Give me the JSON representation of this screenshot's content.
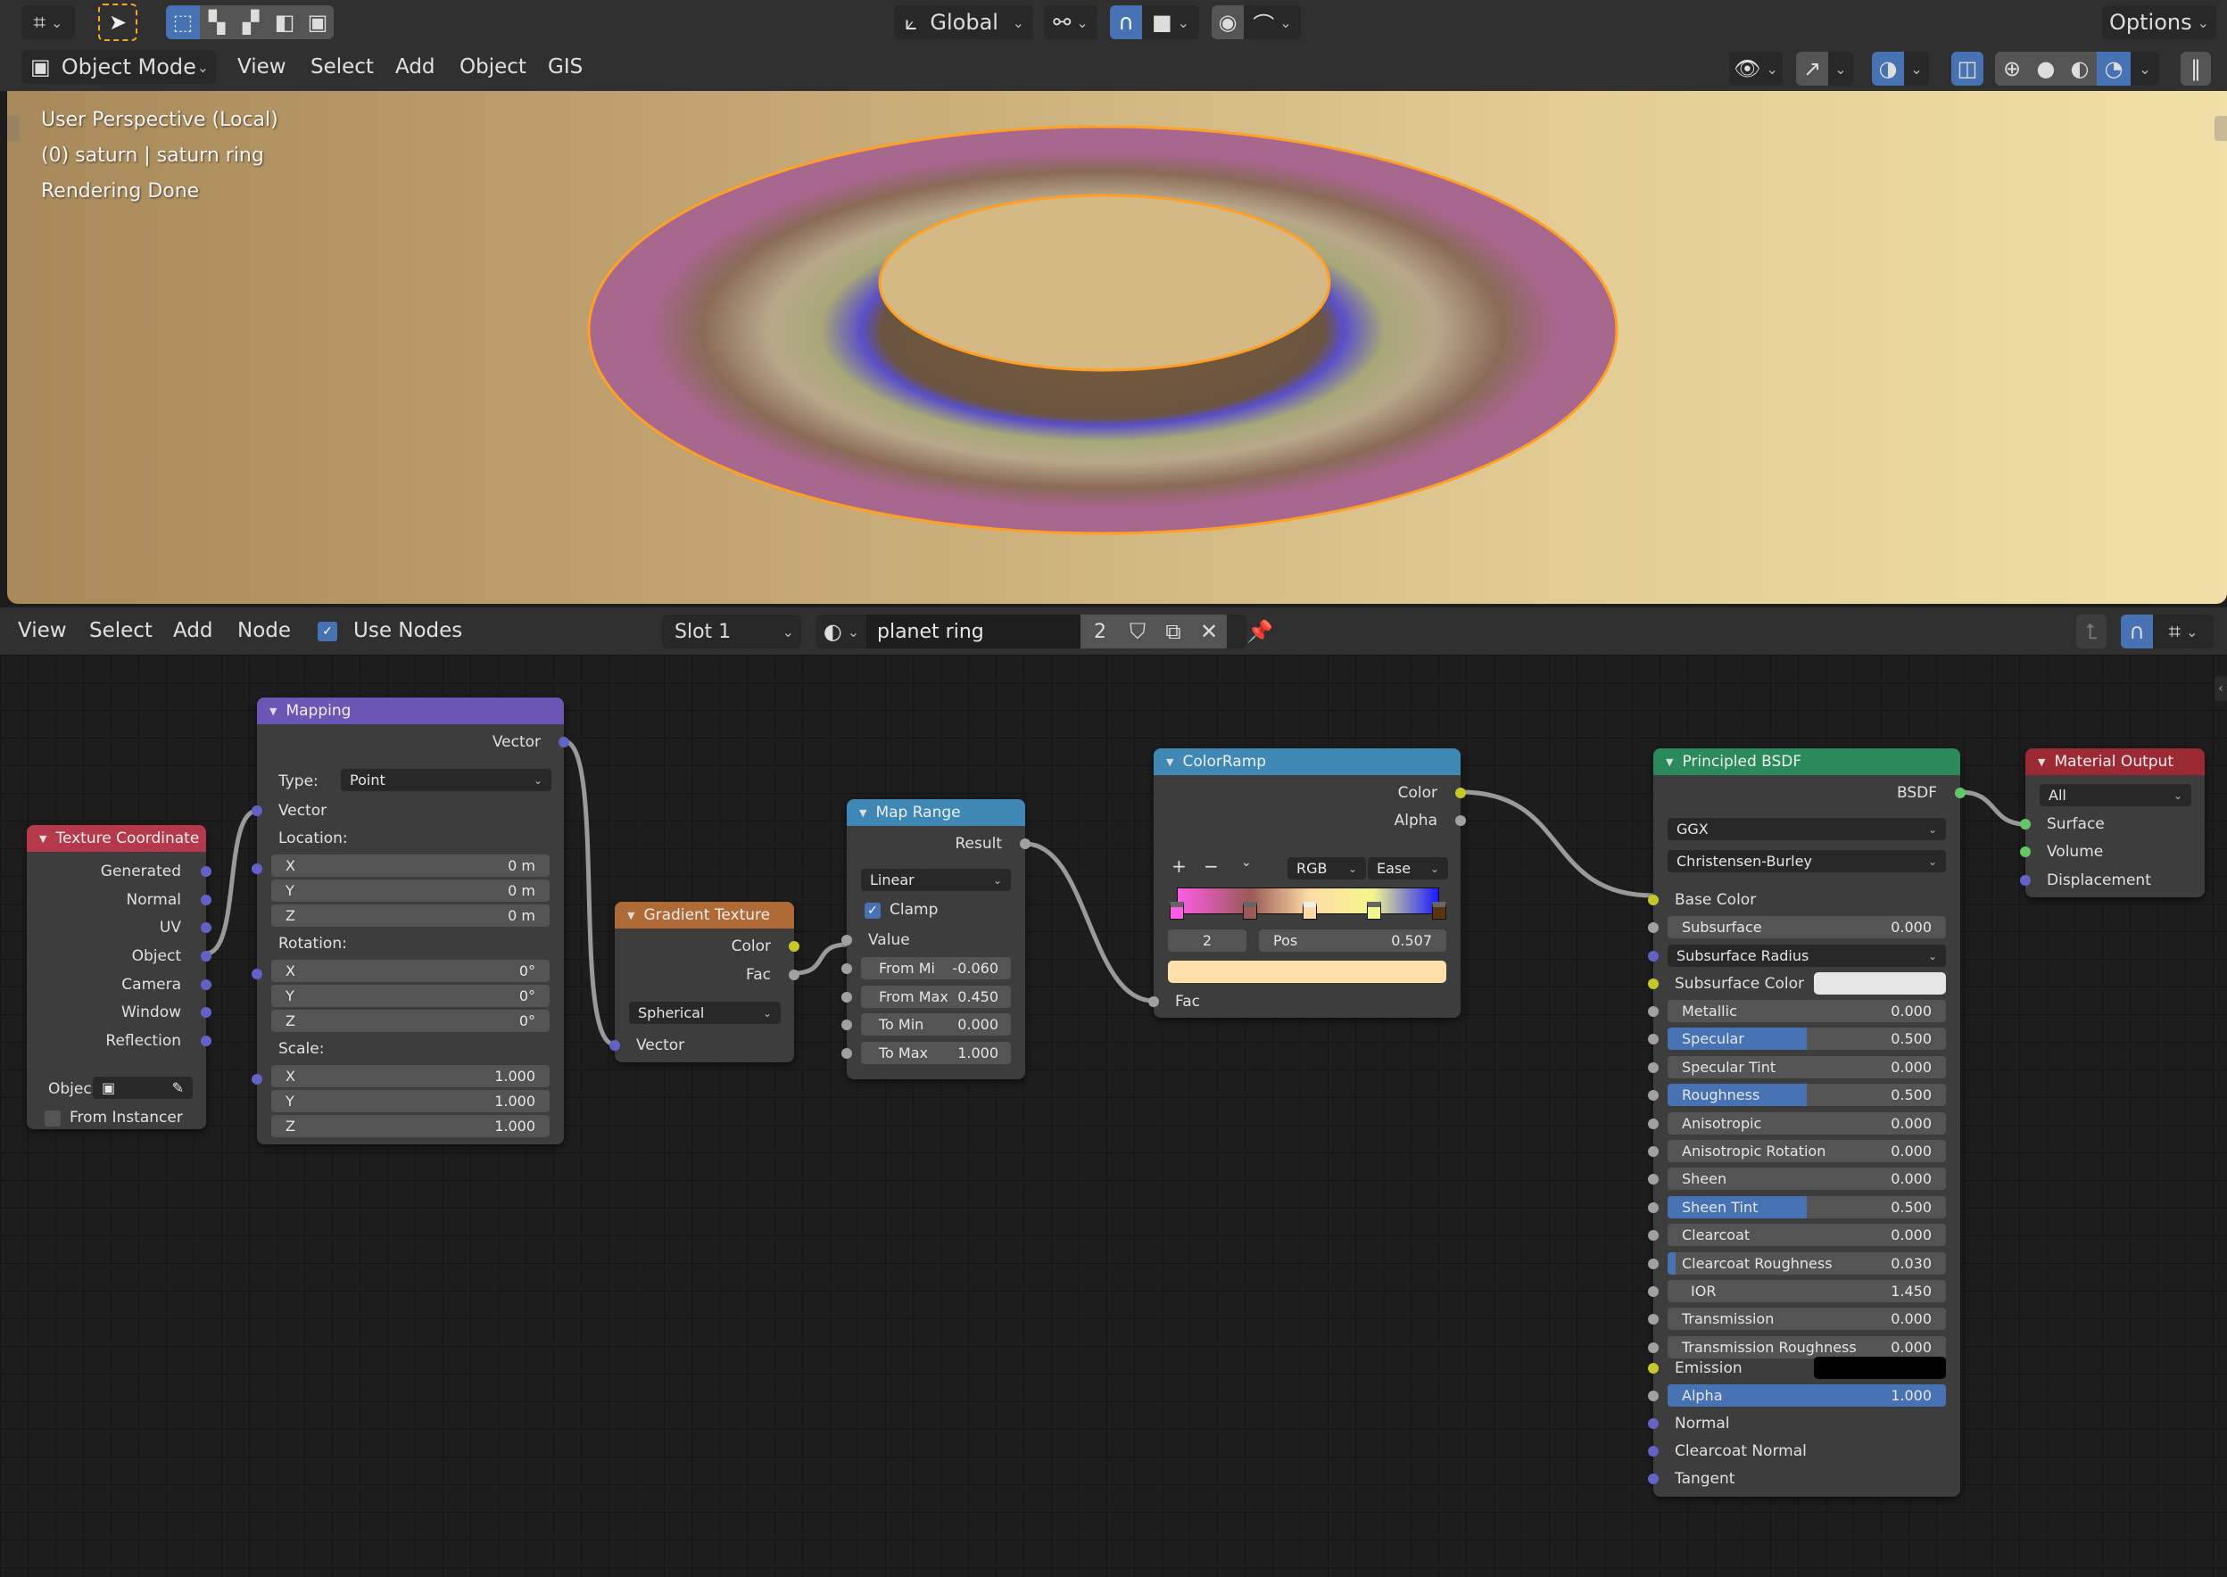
{
  "topbar": {
    "orientation": "Global",
    "options": "Options",
    "mode": "Object Mode",
    "menus": [
      "View",
      "Select",
      "Add",
      "Object",
      "GIS"
    ]
  },
  "viewport": {
    "line1": "User Perspective (Local)",
    "line2": "(0) saturn | saturn ring",
    "line3": "Rendering Done"
  },
  "nodebar": {
    "menus": [
      "View",
      "Select",
      "Add",
      "Node"
    ],
    "use_nodes": "Use Nodes",
    "use_nodes_checked": true,
    "slot": "Slot 1",
    "material": "planet ring",
    "users": "2"
  },
  "nodes": {
    "texcoord": {
      "title": "Texture Coordinate",
      "outputs": [
        "Generated",
        "Normal",
        "UV",
        "Object",
        "Camera",
        "Window",
        "Reflection"
      ],
      "object_label": "Objec",
      "from_instancer": "From Instancer"
    },
    "mapping": {
      "title": "Mapping",
      "output": "Vector",
      "type_label": "Type:",
      "type_value": "Point",
      "input_vector": "Vector",
      "location_label": "Location:",
      "location": [
        {
          "axis": "X",
          "value": "0 m"
        },
        {
          "axis": "Y",
          "value": "0 m"
        },
        {
          "axis": "Z",
          "value": "0 m"
        }
      ],
      "rotation_label": "Rotation:",
      "rotation": [
        {
          "axis": "X",
          "value": "0°"
        },
        {
          "axis": "Y",
          "value": "0°"
        },
        {
          "axis": "Z",
          "value": "0°"
        }
      ],
      "scale_label": "Scale:",
      "scale": [
        {
          "axis": "X",
          "value": "1.000"
        },
        {
          "axis": "Y",
          "value": "1.000"
        },
        {
          "axis": "Z",
          "value": "1.000"
        }
      ]
    },
    "gradient": {
      "title": "Gradient Texture",
      "out_color": "Color",
      "out_fac": "Fac",
      "type": "Spherical",
      "in_vector": "Vector"
    },
    "maprange": {
      "title": "Map Range",
      "output": "Result",
      "interp": "Linear",
      "clamp": "Clamp",
      "value": "Value",
      "fields": [
        {
          "label": "From Mi",
          "value": "-0.060"
        },
        {
          "label": "From Max",
          "value": "0.450"
        },
        {
          "label": "To Min",
          "value": "0.000"
        },
        {
          "label": "To Max",
          "value": "1.000"
        }
      ]
    },
    "colorramp": {
      "title": "ColorRamp",
      "out_color": "Color",
      "out_alpha": "Alpha",
      "plus": "+",
      "minus": "−",
      "color_mode": "RGB",
      "interp": "Ease",
      "active_index": "2",
      "pos_label": "Pos",
      "pos_value": "0.507",
      "active_color": "#ffe0aa",
      "stops": [
        {
          "pos": 0.0,
          "color": "#ff5ce6"
        },
        {
          "pos": 0.28,
          "color": "#9a5a55"
        },
        {
          "pos": 0.507,
          "color": "#ffdca6"
        },
        {
          "pos": 0.75,
          "color": "#f3f58c"
        },
        {
          "pos": 1.0,
          "color": "#5a3310",
          "bar_color": "#1a1aff"
        }
      ],
      "in_fac": "Fac"
    },
    "bsdf": {
      "title": "Principled BSDF",
      "output": "BSDF",
      "distribution": "GGX",
      "subsurface_method": "Christensen-Burley",
      "base_color": "Base Color",
      "subsurface": {
        "label": "Subsurface",
        "value": "0.000",
        "fraction": 0
      },
      "subsurface_radius": "Subsurface Radius",
      "subsurface_color": {
        "label": "Subsurface Color",
        "color": "#e6e6e6"
      },
      "params": [
        {
          "label": "Metallic",
          "value": "0.000",
          "fraction": 0
        },
        {
          "label": "Specular",
          "value": "0.500",
          "fraction": 0.5
        },
        {
          "label": "Specular Tint",
          "value": "0.000",
          "fraction": 0
        },
        {
          "label": "Roughness",
          "value": "0.500",
          "fraction": 0.5
        },
        {
          "label": "Anisotropic",
          "value": "0.000",
          "fraction": 0
        },
        {
          "label": "Anisotropic Rotation",
          "value": "0.000",
          "fraction": 0
        },
        {
          "label": "Sheen",
          "value": "0.000",
          "fraction": 0
        },
        {
          "label": "Sheen Tint",
          "value": "0.500",
          "fraction": 0.5
        },
        {
          "label": "Clearcoat",
          "value": "0.000",
          "fraction": 0
        },
        {
          "label": "Clearcoat Roughness",
          "value": "0.030",
          "fraction": 0.03
        },
        {
          "label": "IOR",
          "value": "1.450",
          "fraction": 0
        },
        {
          "label": "Transmission",
          "value": "0.000",
          "fraction": 0
        },
        {
          "label": "Transmission Roughness",
          "value": "0.000",
          "fraction": 0
        }
      ],
      "emission": {
        "label": "Emission",
        "color": "#000000"
      },
      "alpha": {
        "label": "Alpha",
        "value": "1.000",
        "fraction": 1
      },
      "vectors": [
        "Normal",
        "Clearcoat Normal",
        "Tangent"
      ]
    },
    "output": {
      "title": "Material Output",
      "target": "All",
      "inputs": [
        "Surface",
        "Volume",
        "Displacement"
      ]
    }
  },
  "colors": {
    "accent": "#4772b3",
    "selection_outline": "#ffa024",
    "texcoord_header": "#b5394a",
    "mapping_header": "#6b55b5",
    "gradient_header": "#b06a36",
    "converter_header": "#3f88b5",
    "shader_header": "#2b8a5c",
    "output_header": "#9c2a35"
  }
}
